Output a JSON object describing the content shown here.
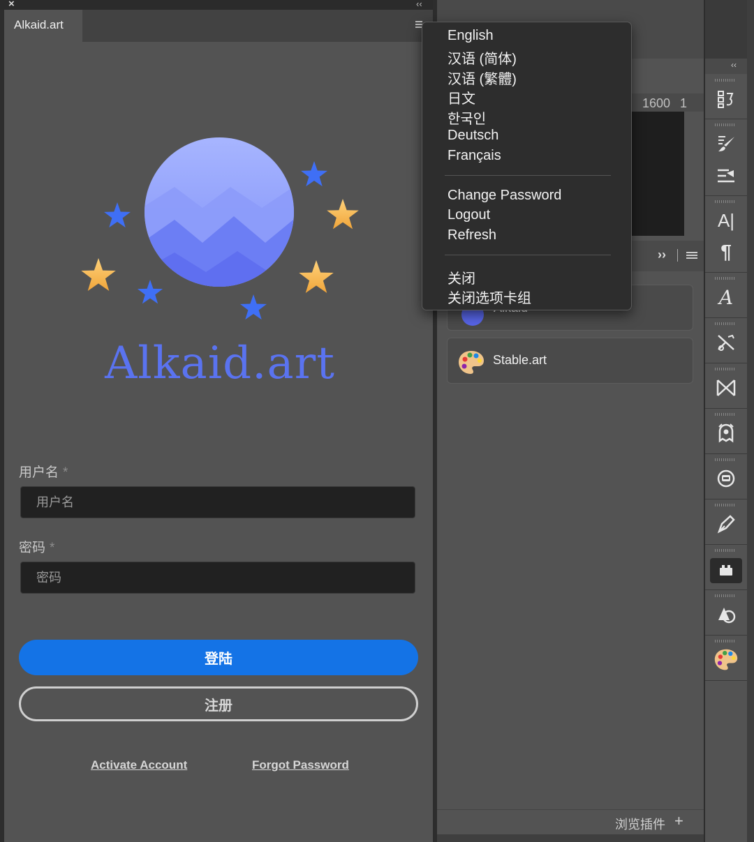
{
  "window": {
    "close_glyph": "×",
    "collapse_glyph": "‹‹"
  },
  "tab": {
    "label": "Alkaid.art"
  },
  "brand": {
    "name": "Alkaid.art"
  },
  "form": {
    "username_label": "用户名",
    "username_placeholder": "用户名",
    "password_label": "密码",
    "password_placeholder": "密码",
    "required_mark": "*",
    "login_label": "登陆",
    "register_label": "注册",
    "activate_label": "Activate Account",
    "forgot_label": "Forgot Password"
  },
  "canvas": {
    "ruler_value": "1600",
    "ruler_next": "1"
  },
  "plugins": {
    "expand_glyph": "››",
    "items": [
      {
        "label": "Alkaid"
      },
      {
        "label": "Stable.art"
      }
    ],
    "browse_label": "浏览插件",
    "browse_plus": "+"
  },
  "menu": {
    "languages": [
      "English",
      "汉语 (简体)",
      "汉语 (繁體)",
      "日文",
      "한국인",
      "Deutsch",
      "Français"
    ],
    "account": [
      "Change Password",
      "Logout",
      "Refresh"
    ],
    "panel": [
      "关闭",
      "关闭选项卡组"
    ]
  },
  "toolbar": {
    "collapse_glyph": "‹‹",
    "icons": [
      "history-icon",
      "brush-settings-icon",
      "tool-presets-icon",
      "character-icon",
      "paragraph-icon",
      "glyphs-icon",
      "adjustments-icon",
      "warp-icon",
      "ghost-plugin-icon",
      "mask-plugin-icon",
      "pen-icon",
      "plugin-panel-icon",
      "shapes-icon",
      "palette-icon"
    ],
    "text_glyphs": {
      "character": "A|",
      "paragraph": "¶",
      "glyphs": "A"
    }
  },
  "colors": {
    "accent_blue": "#1473e6",
    "brand_purple": "#5a73f0",
    "panel_bg": "#535353",
    "menu_bg": "#2d2d2d"
  }
}
